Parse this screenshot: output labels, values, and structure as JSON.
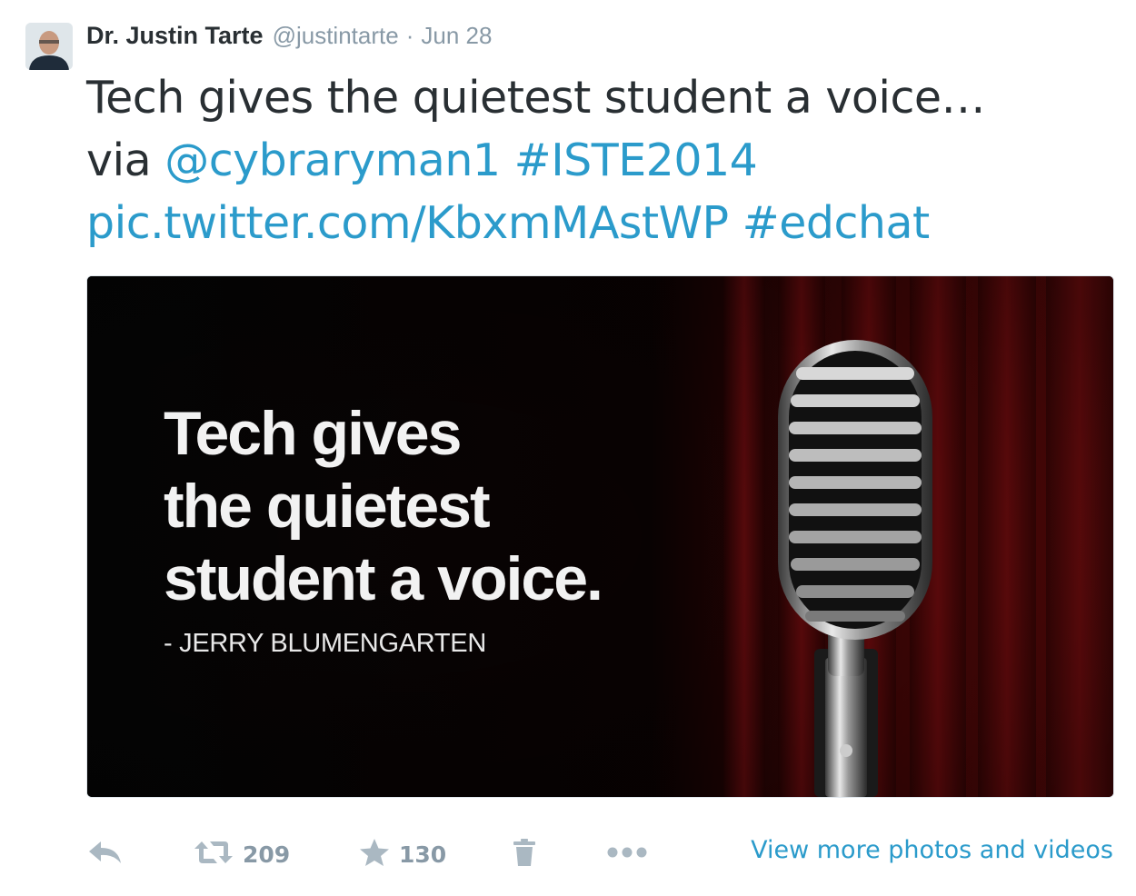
{
  "author": {
    "fullname": "Dr. Justin Tarte",
    "username": "@justintarte",
    "separator": "·",
    "time": "Jun 28"
  },
  "tweet": {
    "text_start": "Tech gives the quietest student a voice…",
    "line2_prefix": "via",
    "mention": "@cybraryman1",
    "hashtag1": "#ISTE2014",
    "pic_link": "pic.twitter.com/KbxmMAstWP",
    "hashtag2": "#edchat"
  },
  "media": {
    "quote_lines": [
      "Tech gives",
      "the quietest",
      "student a voice."
    ],
    "attribution": "- JERRY BLUMENGARTEN"
  },
  "actions": {
    "reply_icon": "reply-icon",
    "retweet_icon": "retweet-icon",
    "retweet_count": "209",
    "favorite_icon": "star-icon",
    "favorite_count": "130",
    "delete_icon": "trash-icon",
    "more_icon": "more-dots-icon",
    "view_more": "View more photos and videos"
  },
  "colors": {
    "link": "#2b9bcb",
    "muted": "#8899a6",
    "icon": "#aab8c2",
    "text": "#292f33",
    "curtain": "#8b0f0f"
  }
}
